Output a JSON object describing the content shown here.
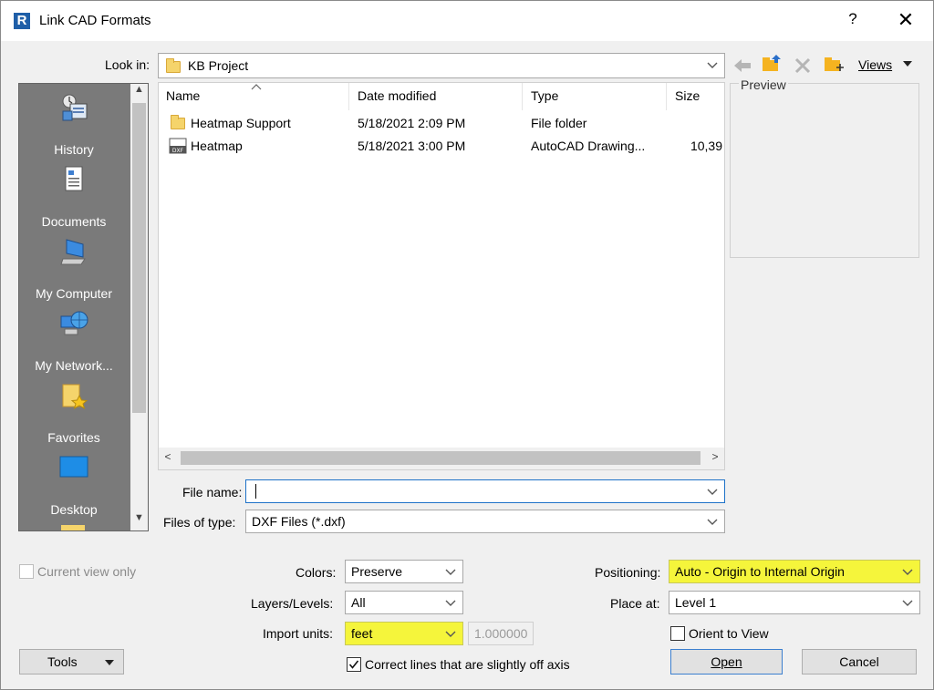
{
  "window": {
    "app_icon": "R",
    "title": "Link CAD Formats",
    "help": "?",
    "close": "✕"
  },
  "lookin": {
    "label": "Look in:",
    "value": "KB Project"
  },
  "toolbar": {
    "views_label": "Views",
    "icons": [
      "back-arrow-icon",
      "up-folder-icon",
      "delete-icon",
      "new-folder-icon",
      "views-icon"
    ]
  },
  "places": [
    {
      "label": "History",
      "icon": "history-icon"
    },
    {
      "label": "Documents",
      "icon": "documents-icon"
    },
    {
      "label": "My Computer",
      "icon": "computer-icon"
    },
    {
      "label": "My Network...",
      "icon": "network-icon"
    },
    {
      "label": "Favorites",
      "icon": "favorites-icon"
    },
    {
      "label": "Desktop",
      "icon": "desktop-icon"
    }
  ],
  "files": {
    "columns": [
      "Name",
      "Date modified",
      "Type",
      "Size"
    ],
    "rows": [
      {
        "name": "Heatmap Support",
        "date": "5/18/2021 2:09 PM",
        "type": "File folder",
        "size": "",
        "icon": "folder-icon"
      },
      {
        "name": "Heatmap",
        "date": "5/18/2021 3:00 PM",
        "type": "AutoCAD Drawing...",
        "size": "10,39",
        "icon": "dxf-file-icon"
      }
    ]
  },
  "preview": {
    "label": "Preview"
  },
  "file_name": {
    "label": "File name:",
    "value": ""
  },
  "files_of_type": {
    "label": "Files of type:",
    "value": "DXF Files  (*.dxf)"
  },
  "options": {
    "current_view_only": "Current view only",
    "colors_label": "Colors:",
    "colors_value": "Preserve",
    "layers_label": "Layers/Levels:",
    "layers_value": "All",
    "import_units_label": "Import units:",
    "import_units_value": "feet",
    "scale_value": "1.000000",
    "correct_lines": "Correct lines that are slightly off axis",
    "positioning_label": "Positioning:",
    "positioning_value": "Auto - Origin to Internal Origin",
    "place_at_label": "Place at:",
    "place_at_value": "Level 1",
    "orient_to_view": "Orient to View"
  },
  "buttons": {
    "tools": "Tools",
    "open": "Open",
    "cancel": "Cancel"
  },
  "colors": {
    "highlight": "#f5f53b",
    "places_bg": "#7a7a7a",
    "focus_border": "#1e72c8"
  }
}
